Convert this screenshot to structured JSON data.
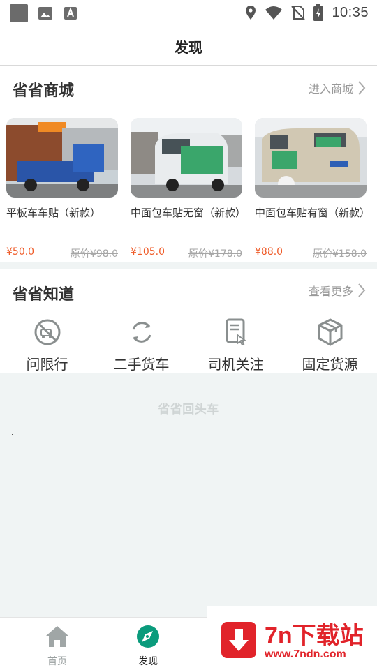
{
  "status_bar": {
    "time": "10:35"
  },
  "header": {
    "title": "发现"
  },
  "shop": {
    "title": "省省商城",
    "more_label": "进入商城",
    "products": [
      {
        "name": "平板车车贴（新款）",
        "price": "¥50.0",
        "original_price": "原价¥98.0"
      },
      {
        "name": "中面包车贴无窗（新款）",
        "price": "¥105.0",
        "original_price": "原价¥178.0"
      },
      {
        "name": "中面包车贴有窗（新款）",
        "price": "¥88.0",
        "original_price": "原价¥158.0"
      }
    ]
  },
  "knowledge": {
    "title": "省省知道",
    "more_label": "查看更多",
    "items": [
      {
        "label": "问限行",
        "icon": "no-vehicle-icon"
      },
      {
        "label": "二手货车",
        "icon": "refresh-icon"
      },
      {
        "label": "司机关注",
        "icon": "document-tap-icon"
      },
      {
        "label": "固定货源",
        "icon": "box-icon"
      }
    ]
  },
  "content": {
    "watermark": "省省回头车"
  },
  "bottom_nav": {
    "items": [
      {
        "label": "首页",
        "icon": "home-icon",
        "active": false
      },
      {
        "label": "发现",
        "icon": "compass-icon",
        "active": true
      }
    ]
  },
  "overlay_badge": {
    "title": "7n下载站",
    "url": "www.7ndn.com"
  },
  "colors": {
    "accent": "#0a9b7c",
    "price": "#ef5b28",
    "inactive": "#9aa0a0",
    "badge": "#e1232a"
  }
}
